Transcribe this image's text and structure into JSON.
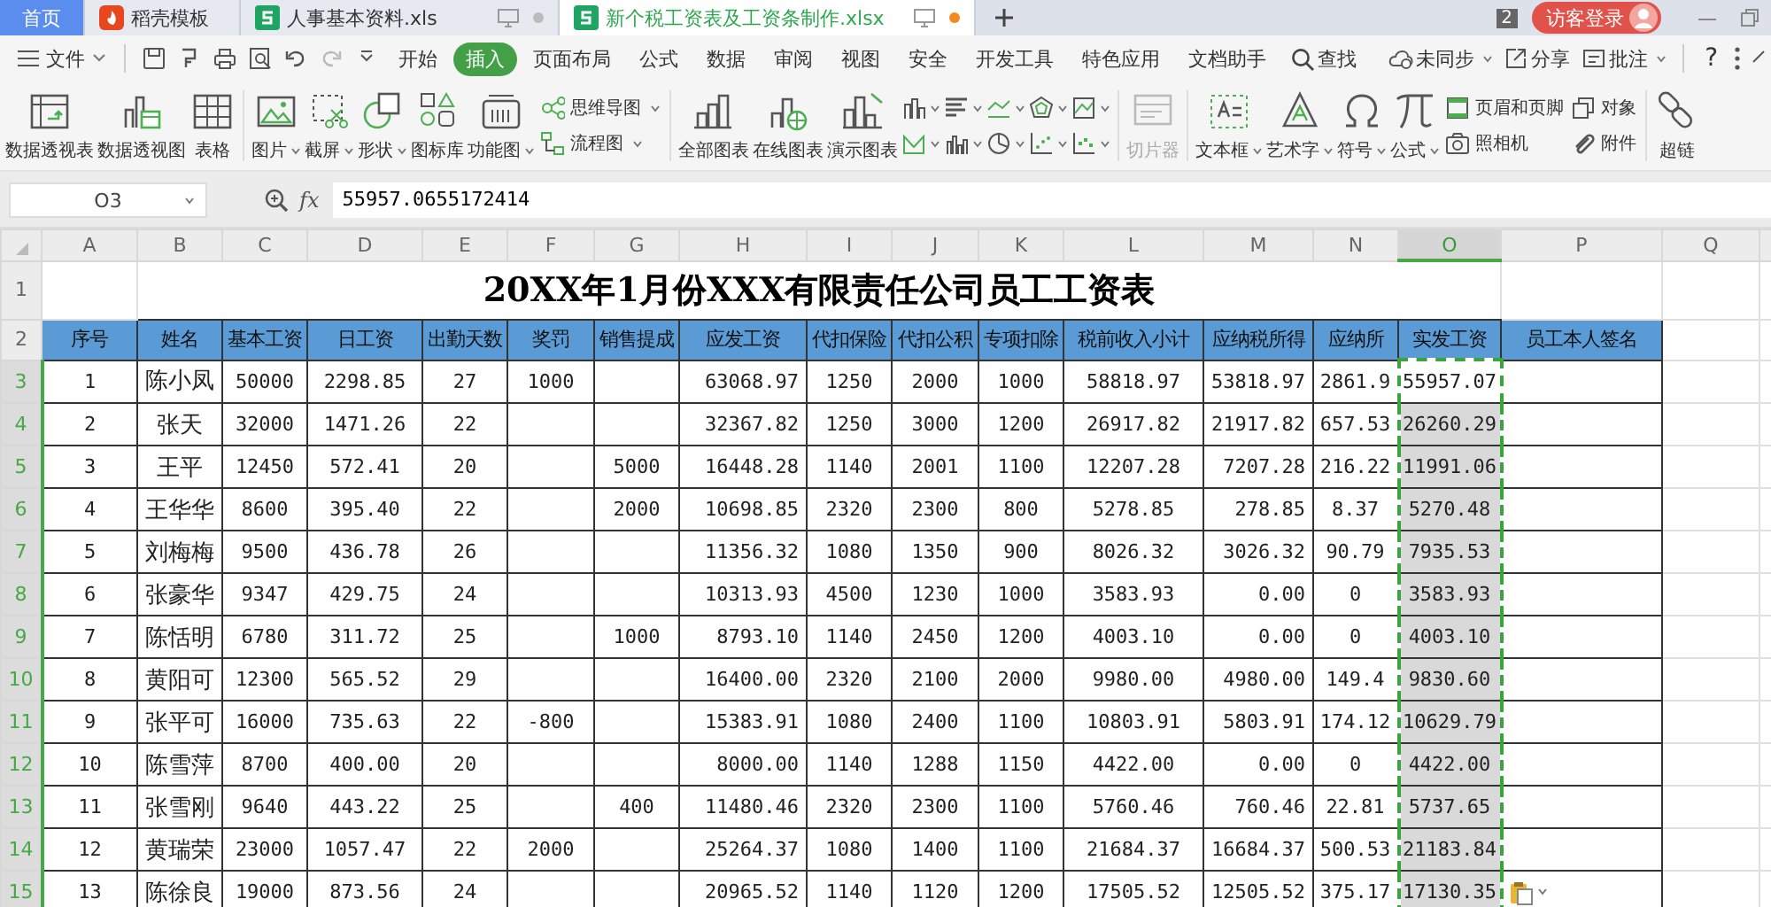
{
  "tabs": [
    {
      "label": "首页",
      "kind": "home",
      "selected": false
    },
    {
      "label": "稻壳模板",
      "kind": "docer",
      "selected": false
    },
    {
      "label": "人事基本资料.xls",
      "kind": "sheet",
      "selected": false,
      "modified": false
    },
    {
      "label": "新个税工资表及工资条制作.xlsx",
      "kind": "sheet",
      "selected": true,
      "modified": true
    }
  ],
  "notification_count": "2",
  "login_button": "访客登录",
  "menu": {
    "file": "文件",
    "items": [
      {
        "label": "开始",
        "selected": false
      },
      {
        "label": "插入",
        "selected": true
      },
      {
        "label": "页面布局",
        "selected": false
      },
      {
        "label": "公式",
        "selected": false
      },
      {
        "label": "数据",
        "selected": false
      },
      {
        "label": "审阅",
        "selected": false
      },
      {
        "label": "视图",
        "selected": false
      },
      {
        "label": "安全",
        "selected": false
      },
      {
        "label": "开发工具",
        "selected": false
      },
      {
        "label": "特色应用",
        "selected": false
      },
      {
        "label": "文档助手",
        "selected": false
      }
    ],
    "search": "查找",
    "right": [
      {
        "label": "未同步",
        "dropdown": true
      },
      {
        "label": "分享",
        "dropdown": false
      },
      {
        "label": "批注",
        "dropdown": true
      }
    ],
    "help": "?"
  },
  "ribbon": [
    {
      "kind": "large",
      "label": "数据透视表"
    },
    {
      "kind": "large",
      "label": "数据透视图"
    },
    {
      "kind": "large",
      "label": "表格"
    },
    {
      "kind": "separator"
    },
    {
      "kind": "large",
      "label": "图片",
      "dropdown": true
    },
    {
      "kind": "large",
      "label": "截屏",
      "dropdown": true
    },
    {
      "kind": "large",
      "label": "形状",
      "dropdown": true
    },
    {
      "kind": "large",
      "label": "图标库"
    },
    {
      "kind": "large",
      "label": "功能图",
      "dropdown": true
    },
    {
      "kind": "stack",
      "items": [
        {
          "label": "思维导图",
          "dropdown": true
        },
        {
          "label": "流程图",
          "dropdown": true
        }
      ]
    },
    {
      "kind": "separator"
    },
    {
      "kind": "large",
      "label": "全部图表"
    },
    {
      "kind": "large",
      "label": "在线图表"
    },
    {
      "kind": "large",
      "label": "演示图表"
    },
    {
      "kind": "grid",
      "items": [
        {
          "dropdown": true
        },
        {
          "dropdown": true
        },
        {
          "dropdown": true
        },
        {
          "dropdown": true
        },
        {
          "dropdown": true
        },
        {
          "dropdown": true
        },
        {
          "dropdown": true
        },
        {
          "dropdown": true
        },
        {
          "dropdown": true
        },
        {
          "dropdown": true
        }
      ]
    },
    {
      "kind": "separator"
    },
    {
      "kind": "large",
      "label": "切片器",
      "disabled": true
    },
    {
      "kind": "separator"
    },
    {
      "kind": "large",
      "label": "文本框",
      "dropdown": true
    },
    {
      "kind": "large",
      "label": "艺术字",
      "dropdown": true
    },
    {
      "kind": "large",
      "label": "符号",
      "dropdown": true
    },
    {
      "kind": "large",
      "label": "公式",
      "dropdown": true
    },
    {
      "kind": "stack",
      "items": [
        {
          "label": "页眉和页脚"
        },
        {
          "label": "照相机"
        }
      ]
    },
    {
      "kind": "stack",
      "items": [
        {
          "label": "对象"
        },
        {
          "label": "附件"
        }
      ]
    },
    {
      "kind": "separator"
    },
    {
      "kind": "large",
      "label": "超链"
    }
  ],
  "formula_bar": {
    "cell": "O3",
    "fx": "fx",
    "value": "55957.0655172414"
  },
  "sheet": {
    "columns": [
      {
        "label": "A",
        "selected": false
      },
      {
        "label": "B",
        "selected": false
      },
      {
        "label": "C",
        "selected": false
      },
      {
        "label": "D",
        "selected": false
      },
      {
        "label": "E",
        "selected": false
      },
      {
        "label": "F",
        "selected": false
      },
      {
        "label": "G",
        "selected": false
      },
      {
        "label": "H",
        "selected": false
      },
      {
        "label": "I",
        "selected": false
      },
      {
        "label": "J",
        "selected": false
      },
      {
        "label": "K",
        "selected": false
      },
      {
        "label": "L",
        "selected": false
      },
      {
        "label": "M",
        "selected": false
      },
      {
        "label": "N",
        "selected": false
      },
      {
        "label": "O",
        "selected": true
      },
      {
        "label": "P",
        "selected": false
      },
      {
        "label": "Q",
        "selected": false
      }
    ],
    "title_row": {
      "number": "1",
      "title": "20XX年1月份XXX有限责任公司员工工资表"
    },
    "header_row": {
      "number": "2",
      "cells": [
        "序号",
        "姓名",
        "基本工资",
        "日工资",
        "出勤天数",
        "奖罚",
        "销售提成",
        "应发工资",
        "代扣保险",
        "代扣公积",
        "专项扣除",
        "税前收入小计",
        "应纳税所得",
        "应纳所",
        "实发工资",
        "员工本人签名"
      ]
    },
    "rows": [
      {
        "number": "3",
        "selected": true,
        "cells": [
          "1",
          "陈小凤",
          "50000",
          "2298.85",
          "27",
          "1000",
          null,
          "63068.97",
          "1250",
          "2000",
          "1000",
          "58818.97",
          "53818.97",
          "2861.9",
          "55957.07",
          null
        ]
      },
      {
        "number": "4",
        "selected": true,
        "cells": [
          "2",
          "张天",
          "32000",
          "1471.26",
          "22",
          null,
          null,
          "32367.82",
          "1250",
          "3000",
          "1200",
          "26917.82",
          "21917.82",
          "657.53",
          "26260.29",
          null
        ]
      },
      {
        "number": "5",
        "selected": true,
        "cells": [
          "3",
          "王平",
          "12450",
          "572.41",
          "20",
          null,
          "5000",
          "16448.28",
          "1140",
          "2001",
          "1100",
          "12207.28",
          "7207.28",
          "216.22",
          "11991.06",
          null
        ]
      },
      {
        "number": "6",
        "selected": true,
        "cells": [
          "4",
          "王华华",
          "8600",
          "395.40",
          "22",
          null,
          "2000",
          "10698.85",
          "2320",
          "2300",
          "800",
          "5278.85",
          "278.85",
          "8.37",
          "5270.48",
          null
        ]
      },
      {
        "number": "7",
        "selected": true,
        "cells": [
          "5",
          "刘梅梅",
          "9500",
          "436.78",
          "26",
          null,
          null,
          "11356.32",
          "1080",
          "1350",
          "900",
          "8026.32",
          "3026.32",
          "90.79",
          "7935.53",
          null
        ]
      },
      {
        "number": "8",
        "selected": true,
        "cells": [
          "6",
          "张豪华",
          "9347",
          "429.75",
          "24",
          null,
          null,
          "10313.93",
          "4500",
          "1230",
          "1000",
          "3583.93",
          "0.00",
          "0",
          "3583.93",
          null
        ]
      },
      {
        "number": "9",
        "selected": true,
        "cells": [
          "7",
          "陈恬明",
          "6780",
          "311.72",
          "25",
          null,
          "1000",
          "8793.10",
          "1140",
          "2450",
          "1200",
          "4003.10",
          "0.00",
          "0",
          "4003.10",
          null
        ]
      },
      {
        "number": "10",
        "selected": true,
        "cells": [
          "8",
          "黄阳可",
          "12300",
          "565.52",
          "29",
          null,
          null,
          "16400.00",
          "2320",
          "2100",
          "2000",
          "9980.00",
          "4980.00",
          "149.4",
          "9830.60",
          null
        ]
      },
      {
        "number": "11",
        "selected": true,
        "cells": [
          "9",
          "张平可",
          "16000",
          "735.63",
          "22",
          "-800",
          null,
          "15383.91",
          "1080",
          "2400",
          "1100",
          "10803.91",
          "5803.91",
          "174.12",
          "10629.79",
          null
        ]
      },
      {
        "number": "12",
        "selected": true,
        "cells": [
          "10",
          "陈雪萍",
          "8700",
          "400.00",
          "20",
          null,
          null,
          "8000.00",
          "1140",
          "1288",
          "1150",
          "4422.00",
          "0.00",
          "0",
          "4422.00",
          null
        ]
      },
      {
        "number": "13",
        "selected": true,
        "cells": [
          "11",
          "张雪刚",
          "9640",
          "443.22",
          "25",
          null,
          "400",
          "11480.46",
          "2320",
          "2300",
          "1100",
          "5760.46",
          "760.46",
          "22.81",
          "5737.65",
          null
        ]
      },
      {
        "number": "14",
        "selected": true,
        "cells": [
          "12",
          "黄瑞荣",
          "23000",
          "1057.47",
          "22",
          "2000",
          null,
          "25264.37",
          "1080",
          "1400",
          "1100",
          "21684.37",
          "16684.37",
          "500.53",
          "21183.84",
          null
        ]
      },
      {
        "number": "15",
        "selected": true,
        "cells": [
          "13",
          "陈徐良",
          "19000",
          "873.56",
          "24",
          null,
          null,
          "20965.52",
          "1140",
          "1120",
          "1200",
          "17505.52",
          "12505.52",
          "375.17",
          "17130.35",
          null
        ]
      }
    ],
    "paste_options": true
  }
}
